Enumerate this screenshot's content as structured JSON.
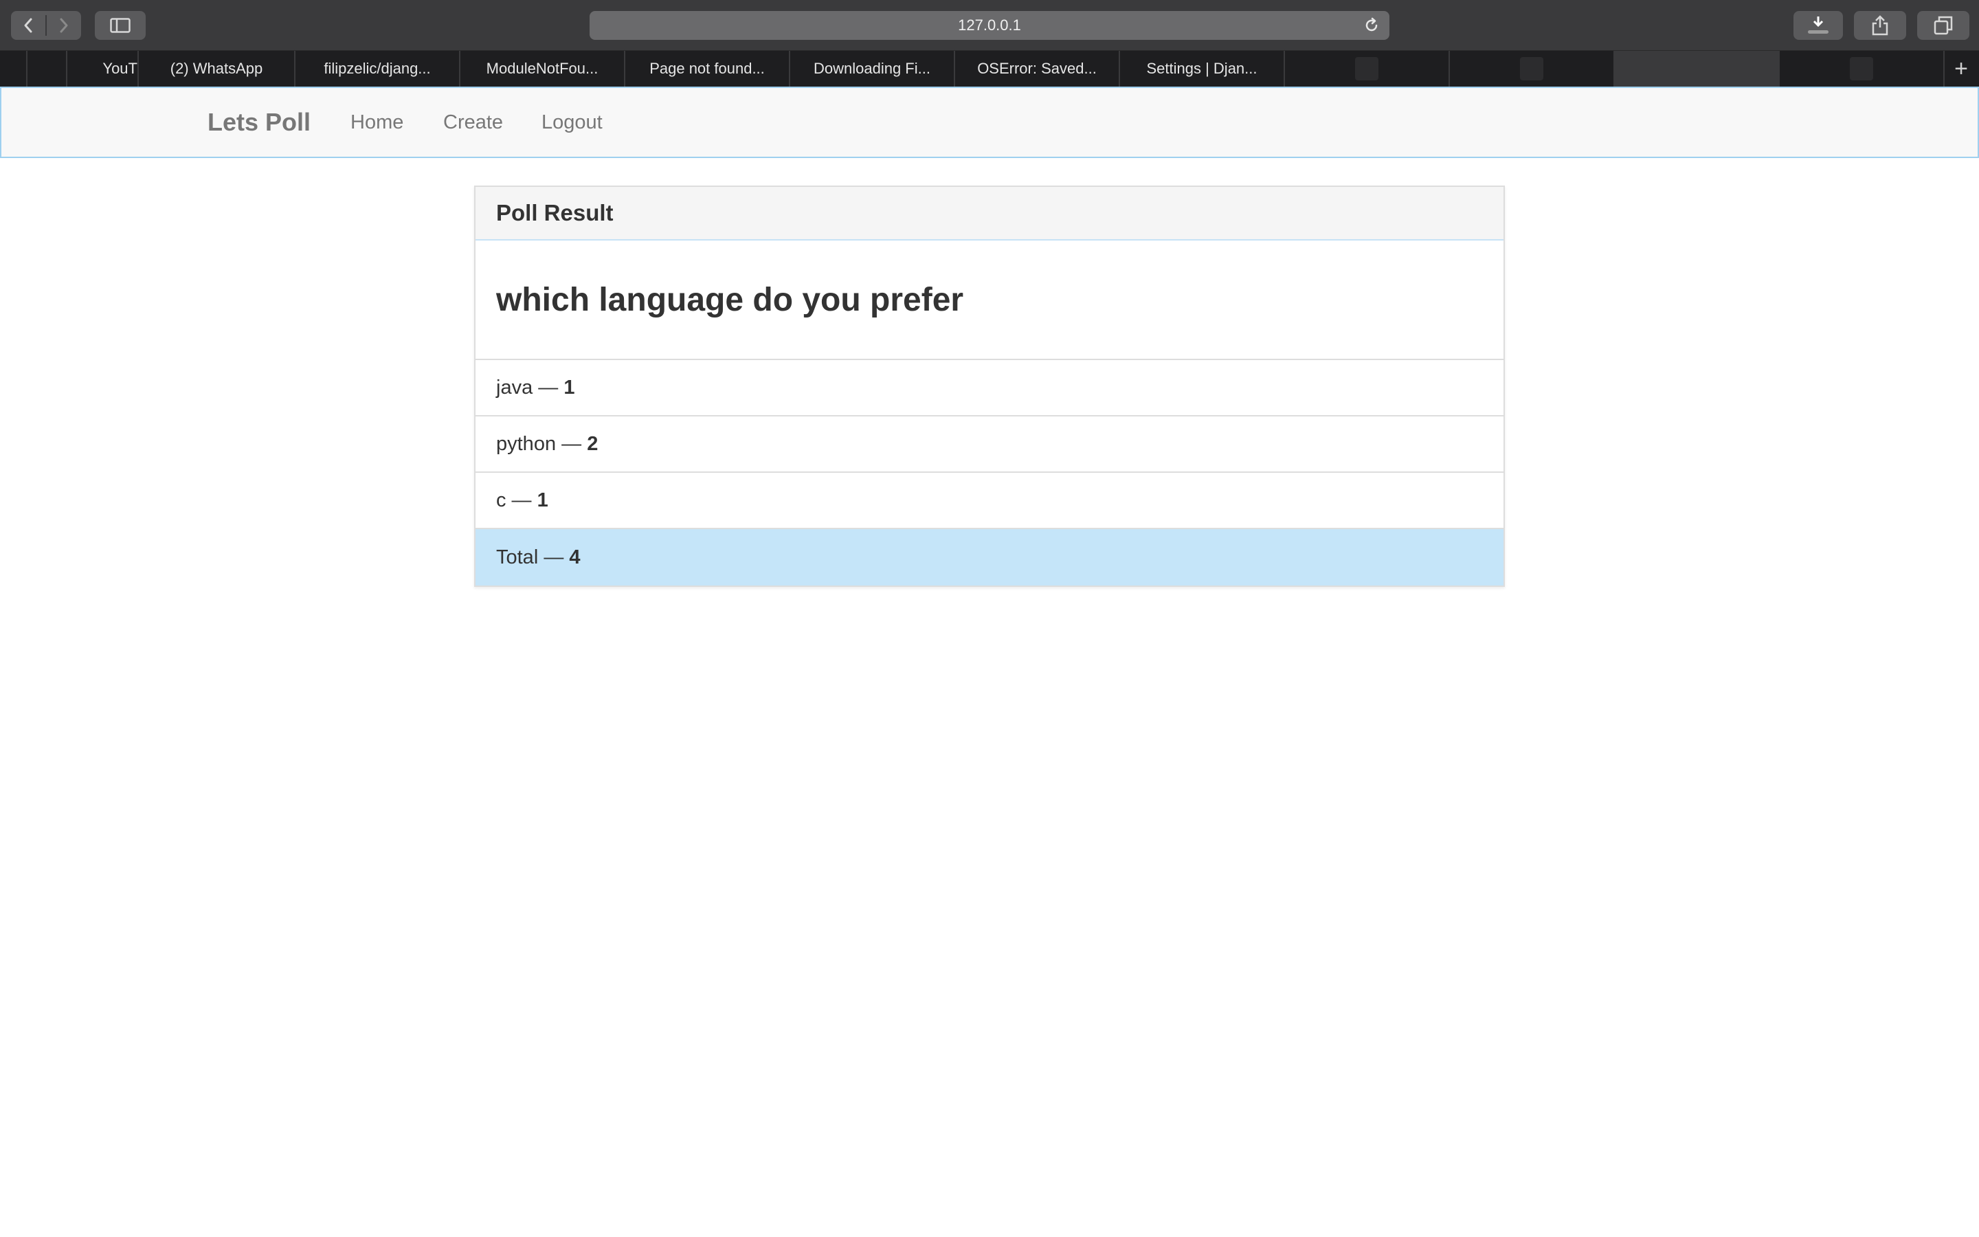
{
  "browser": {
    "url": "127.0.0.1",
    "tabs": [
      {
        "title": "",
        "kind": "icon"
      },
      {
        "title": "",
        "kind": "icon"
      },
      {
        "title": "YouT",
        "kind": "text"
      },
      {
        "title": "(2) WhatsApp",
        "kind": "text"
      },
      {
        "title": "filipzelic/djang...",
        "kind": "text"
      },
      {
        "title": "ModuleNotFou...",
        "kind": "text"
      },
      {
        "title": "Page not found...",
        "kind": "text"
      },
      {
        "title": "Downloading Fi...",
        "kind": "text"
      },
      {
        "title": "OSError: Saved...",
        "kind": "text"
      },
      {
        "title": "Settings | Djan...",
        "kind": "text"
      },
      {
        "title": "",
        "kind": "blank"
      },
      {
        "title": "",
        "kind": "blank"
      },
      {
        "title": "",
        "kind": "active"
      },
      {
        "title": "",
        "kind": "blank"
      }
    ],
    "new_tab_label": "+"
  },
  "navbar": {
    "brand": "Lets Poll",
    "links": [
      "Home",
      "Create",
      "Logout"
    ]
  },
  "panel": {
    "heading": "Poll Result",
    "question": "which language do you prefer",
    "results": [
      {
        "choice": "java",
        "separator": " — ",
        "votes": "1"
      },
      {
        "choice": "python",
        "separator": " — ",
        "votes": "2"
      },
      {
        "choice": "c",
        "separator": " — ",
        "votes": "1"
      }
    ],
    "total": {
      "label": "Total",
      "separator": " — ",
      "votes": "4"
    }
  },
  "colors": {
    "chrome_toolbar": "#3a3a3c",
    "tabbar": "#1e1e20",
    "navbar_bg": "#f8f8f8",
    "total_row_bg": "#c5e5f9"
  }
}
